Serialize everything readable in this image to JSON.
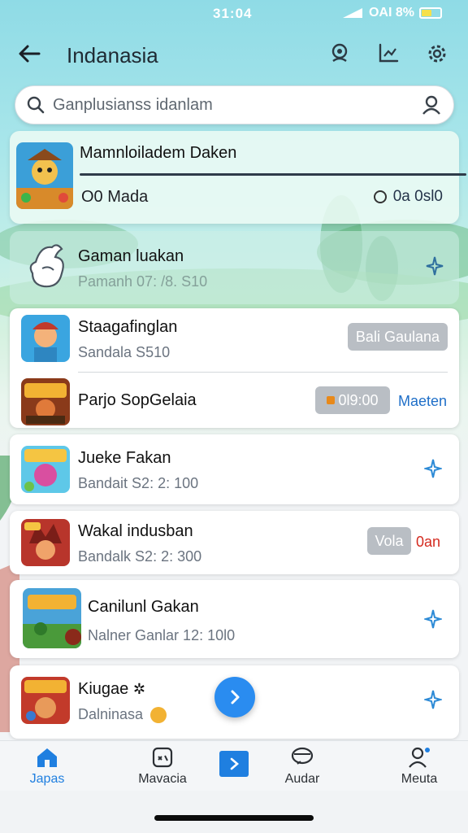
{
  "status_bar": {
    "time": "31:04",
    "signal_text": "OAI 8%"
  },
  "header": {
    "title": "Indanasia"
  },
  "search": {
    "placeholder": "Ganplusianss idanlam"
  },
  "featured": {
    "title": "Mamnloiladem Daken",
    "option_left": "O0 Mada",
    "option_right": "0a 0sl0"
  },
  "banner": {
    "title": "Gaman luakan",
    "subtitle": "Pamanh 07: /8. S10"
  },
  "games": [
    {
      "name": "Staagafinglan",
      "sub": "Sandala S510",
      "pill": "Bali Gaulana"
    },
    {
      "name": "Parjo SopGelaia",
      "pill": "0l9:00",
      "link": "Maeten"
    },
    {
      "name": "Jueke Fakan",
      "sub": "Bandait S2: 2: 100"
    },
    {
      "name": "Wakal indusban",
      "sub": "Bandalk S2: 2: 300",
      "pill": "Vola",
      "link": "0an"
    },
    {
      "name": "Canilunl Gakan",
      "sub": "Nalner Ganlar 12: 10l0"
    },
    {
      "name": "Kiugae",
      "sub": "Dalninasa"
    }
  ],
  "bottom_nav": [
    {
      "label": "Japas",
      "icon": "home-icon",
      "active": true
    },
    {
      "label": "Mavacia",
      "icon": "controller-icon"
    },
    {
      "label": "",
      "icon": "play-icon"
    },
    {
      "label": "Audar",
      "icon": "chat-icon"
    },
    {
      "label": "Meuta",
      "icon": "person-icon"
    }
  ],
  "colors": {
    "accent": "#2a8cf0",
    "link_blue": "#1f6fc8",
    "link_red": "#d42a1f",
    "pill_gray": "#b9bec4",
    "sky": "#8fdbe6"
  }
}
